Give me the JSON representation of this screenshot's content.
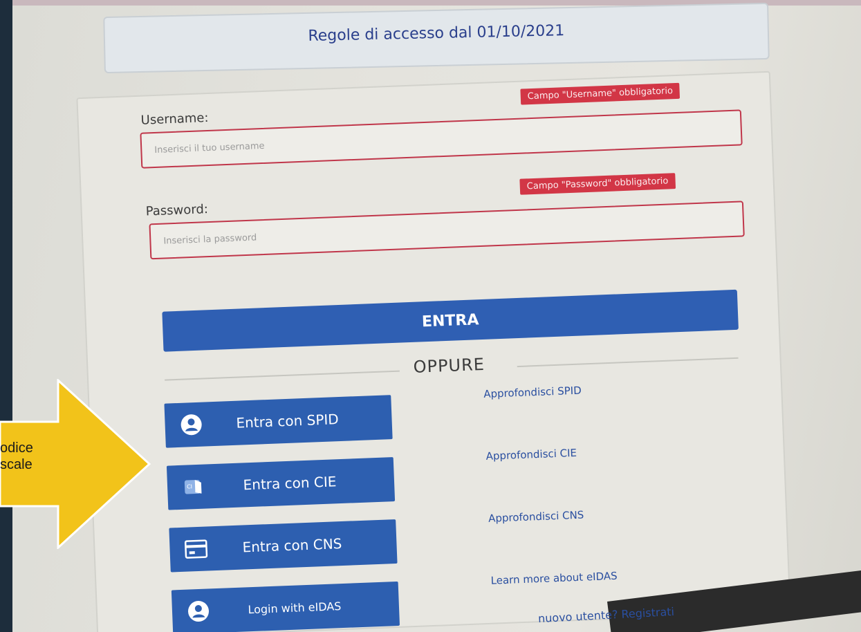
{
  "header": {
    "title": "Regole di accesso dal 01/10/2021"
  },
  "form": {
    "username_label": "Username:",
    "username_error": "Campo \"Username\" obbligatorio",
    "username_placeholder": "Inserisci il tuo username",
    "password_label": "Password:",
    "password_error": "Campo \"Password\" obbligatorio",
    "password_placeholder": "Inserisci la password",
    "submit_label": "ENTRA"
  },
  "alternatives": {
    "divider_label": "OPPURE",
    "buttons": [
      {
        "label": "Entra con SPID",
        "icon": "user-icon"
      },
      {
        "label": "Entra con CIE",
        "icon": "id-card-icon"
      },
      {
        "label": "Entra con CNS",
        "icon": "credit-card-icon"
      },
      {
        "label": "Login with eIDAS",
        "icon": "user-icon"
      }
    ],
    "links": [
      "Approfondisci SPID",
      "Approfondisci CIE",
      "Approfondisci CNS",
      "Learn more about eIDAS"
    ]
  },
  "footer": {
    "register_text": "nuovo utente? Registrati"
  },
  "annotation": {
    "line1": "odice",
    "line2": "scale",
    "color": "#f2c31a"
  },
  "colors": {
    "primary": "#2f5fb3",
    "error": "#d23646",
    "title": "#2a3f8c"
  }
}
